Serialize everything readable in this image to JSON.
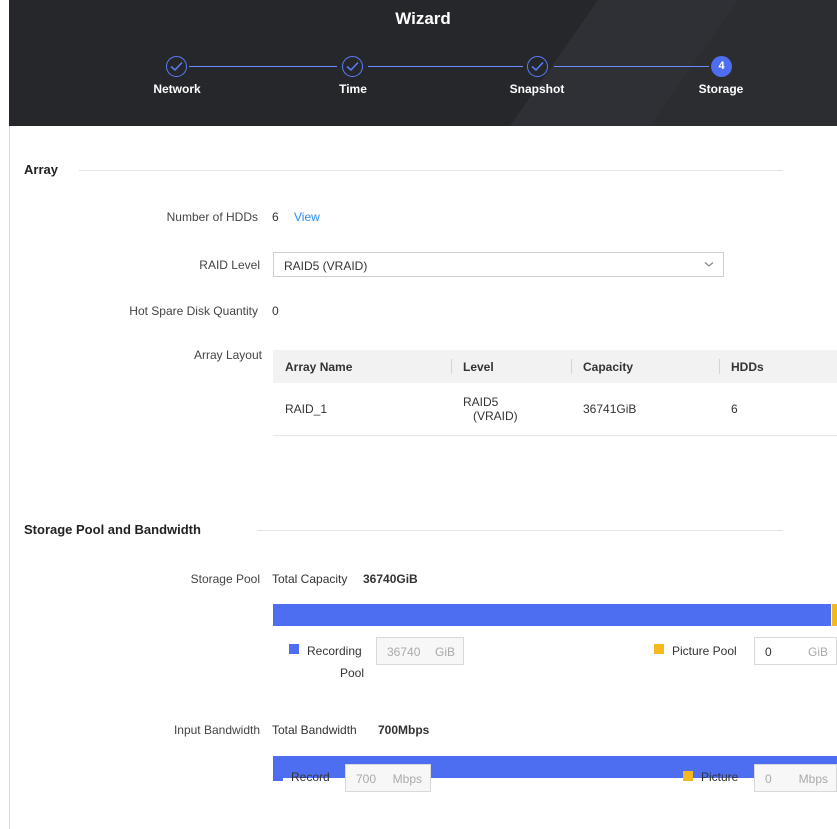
{
  "wizard": {
    "title": "Wizard",
    "steps": [
      {
        "label": "Network",
        "state": "done"
      },
      {
        "label": "Time",
        "state": "done"
      },
      {
        "label": "Snapshot",
        "state": "done"
      },
      {
        "label": "Storage",
        "state": "current",
        "number": "4"
      }
    ]
  },
  "array_section": {
    "title": "Array",
    "number_of_hdds_label": "Number of HDDs",
    "number_of_hdds_value": "6",
    "view_link": "View",
    "raid_level_label": "RAID Level",
    "raid_level_value": "RAID5  (VRAID)",
    "hot_spare_label": "Hot Spare Disk Quantity",
    "hot_spare_value": "0",
    "array_layout_label": "Array Layout",
    "table": {
      "headers": [
        "Array Name",
        "Level",
        "Capacity",
        "HDDs"
      ],
      "rows": [
        {
          "name": "RAID_1",
          "level_line1": "RAID5",
          "level_line2": "(VRAID)",
          "capacity": "36741GiB",
          "hdds": "6"
        }
      ]
    }
  },
  "storage_section": {
    "title": "Storage Pool and Bandwidth",
    "storage_pool_label": "Storage Pool",
    "total_capacity_label": "Total Capacity",
    "total_capacity_value": "36740GiB",
    "recording_pool_label_line1": "Recording",
    "recording_pool_label_line2": "Pool",
    "recording_pool_value": "36740",
    "recording_pool_unit": "GiB",
    "picture_pool_label": "Picture Pool",
    "picture_pool_value": "0",
    "picture_pool_unit": "GiB",
    "input_bandwidth_label": "Input Bandwidth",
    "total_bandwidth_label": "Total Bandwidth",
    "total_bandwidth_value": "700Mbps",
    "record_label": "Record",
    "record_value": "700",
    "record_unit": "Mbps",
    "picture_label": "Picture",
    "picture_value": "0",
    "picture_unit": "Mbps"
  },
  "colors": {
    "header_bg": "#26272b",
    "accent_blue": "#4e6ef2",
    "accent_yellow": "#f5b81f",
    "link_blue": "#2d8cf0"
  }
}
